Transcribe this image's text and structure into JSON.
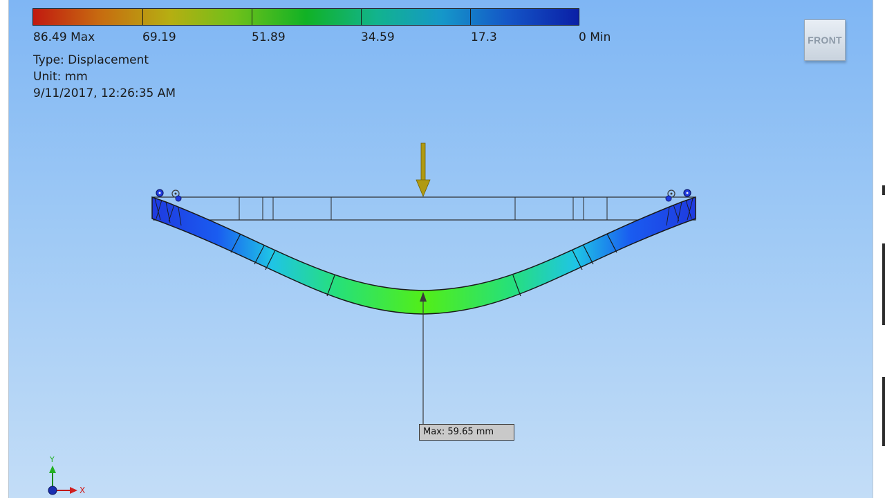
{
  "legend": {
    "labels": [
      "86.49 Max",
      "69.19",
      "51.89",
      "34.59",
      "17.3",
      "0 Min"
    ],
    "colors": [
      "#c11a10",
      "#b6ae12",
      "#11b225",
      "#12b38e",
      "#1597c9",
      "#0a1fa6"
    ]
  },
  "result_info": {
    "type": "Type: Displacement",
    "unit": "Unit: mm",
    "timestamp": "9/11/2017, 12:26:35 AM"
  },
  "view_cube": {
    "face_label": "FRONT"
  },
  "probe": {
    "label": "Max: 59.65 mm"
  },
  "triad": {
    "x_label": "X",
    "y_label": "Y"
  },
  "colors": {
    "viewport_top": "#7fb6f4",
    "viewport_bottom": "#c3ddf7",
    "load_arrow": "#b09a12",
    "beam_deformed_mid": "#3fe020",
    "beam_deformed_end": "#1438d8"
  },
  "icons": [
    "load-arrow-icon",
    "pin-constraint-icon",
    "coordinate-triad-icon",
    "probe-pointer-icon"
  ]
}
